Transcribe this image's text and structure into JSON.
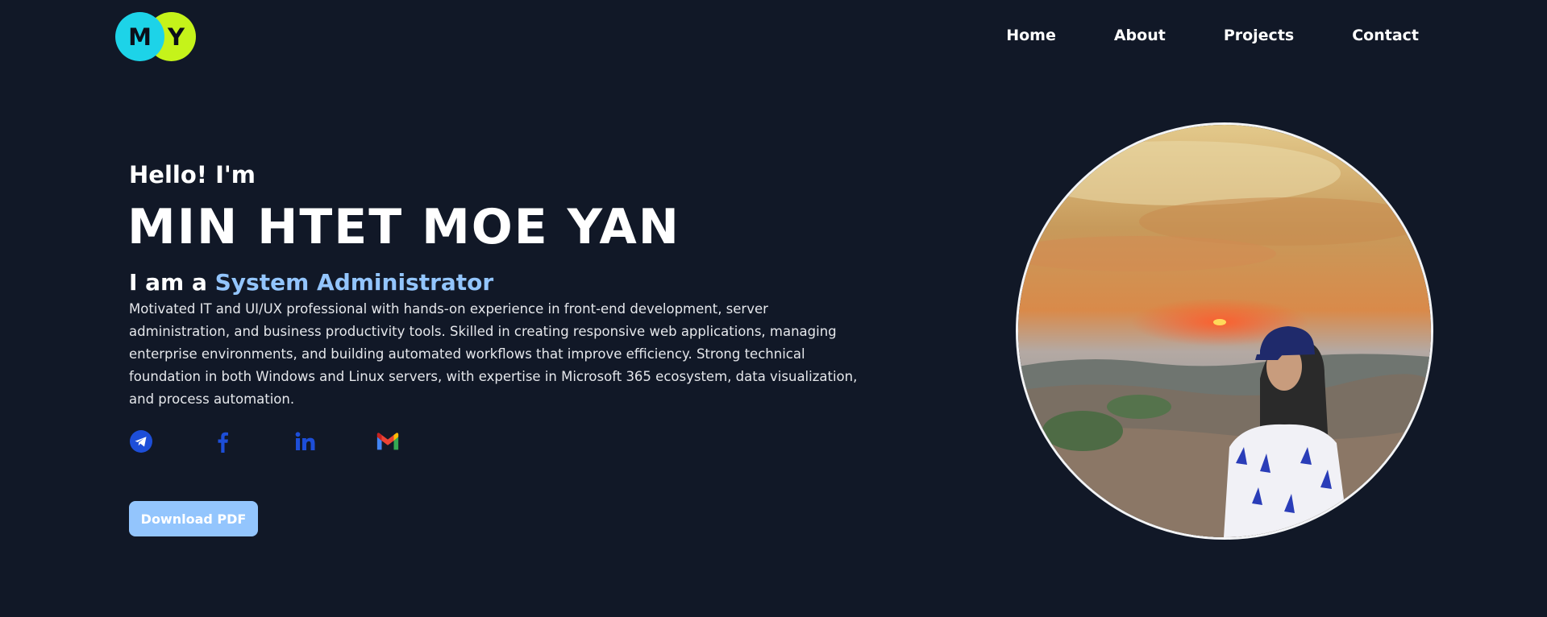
{
  "logo": {
    "letter1": "M",
    "letter2": "Y"
  },
  "nav": {
    "home": "Home",
    "about": "About",
    "projects": "Projects",
    "contact": "Contact"
  },
  "hero": {
    "greeting": "Hello! I'm",
    "name": "MIN HTET MOE YAN",
    "role_prefix": "I am a ",
    "role": "System Administrator",
    "description": "Motivated IT and UI/UX professional with hands-on experience in front-end development, server administration, and business productivity tools. Skilled in creating responsive web applications, managing enterprise environments, and building automated workflows that improve efficiency. Strong technical foundation in both Windows and Linux servers, with expertise in Microsoft 365 ecosystem, data visualization, and process automation.",
    "download_label": "Download PDF"
  },
  "socials": [
    "telegram-icon",
    "facebook-icon",
    "linkedin-icon",
    "gmail-icon"
  ],
  "colors": {
    "background": "#111827",
    "accent": "#93c5fd",
    "logo_cyan": "#1dd3e8",
    "logo_lime": "#c5f31a",
    "icon_blue": "#1d4ed8"
  }
}
